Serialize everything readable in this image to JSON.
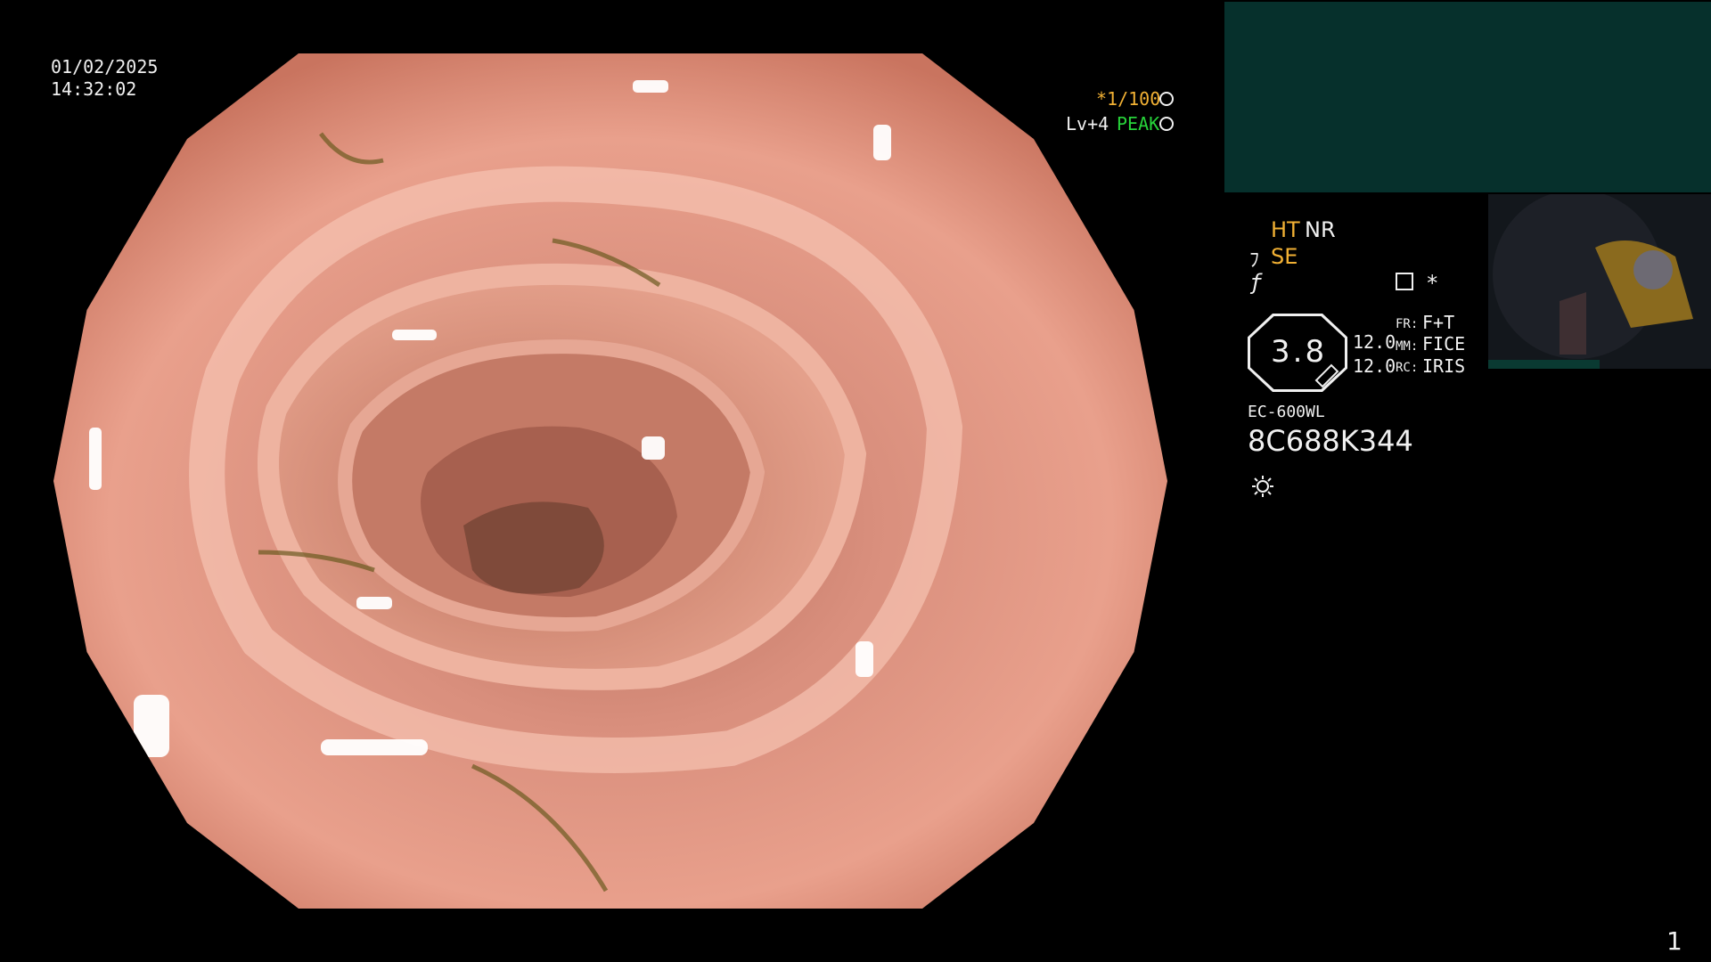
{
  "overlay": {
    "date": "01/02/2025",
    "time": "14:32:02",
    "shutter": "*1/100",
    "shutter_icon": "aperture-icon",
    "level": "Lv+4",
    "peak": "PEAK",
    "peak_icon": "target-icon"
  },
  "panel": {
    "ht": "HT",
    "nr": "NR",
    "se_symbol": "ﾌ",
    "se": "SE",
    "f_symbol": "ƒ",
    "star": "*",
    "zoom_value": "3.8",
    "value_1": "12.0",
    "value_2": "12.0",
    "fr_label": "FR:",
    "fr_value": "F+T",
    "mm_label": "MM:",
    "mm_value": "FICE",
    "rc_label": "RC:",
    "rc_value": "IRIS",
    "model": "EC-600WL",
    "serial": "8C688K344",
    "light_icon": "sun-icon"
  },
  "footer": {
    "page_number": "1"
  },
  "colors": {
    "accent_orange": "#f2b134",
    "peak_green": "#27d33a",
    "teal_panel": "#06302c"
  }
}
